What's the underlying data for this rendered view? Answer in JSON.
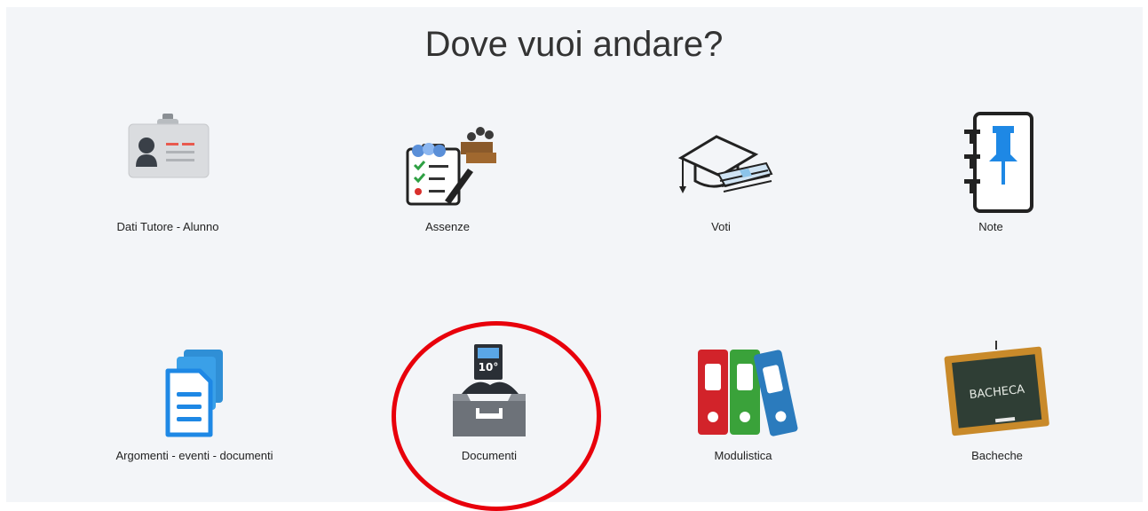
{
  "heading": "Dove vuoi andare?",
  "menu": [
    {
      "label": "Dati Tutore - Alunno",
      "icon": "id-badge-icon"
    },
    {
      "label": "Assenze",
      "icon": "attendance-clipboard-icon"
    },
    {
      "label": "Voti",
      "icon": "graduation-cap-icon"
    },
    {
      "label": "Note",
      "icon": "notebook-pin-icon"
    },
    {
      "label": "Argomenti - eventi - documenti",
      "icon": "documents-stack-icon"
    },
    {
      "label": "Documenti",
      "icon": "document-inbox-icon",
      "highlighted": true
    },
    {
      "label": "Modulistica",
      "icon": "binders-icon"
    },
    {
      "label": "Bacheche",
      "icon": "chalkboard-icon"
    }
  ],
  "icon_texts": {
    "bacheca_board": "BACHECA",
    "doc_badge": "10°"
  },
  "colors": {
    "panel_bg": "#f3f5f8",
    "highlight": "#e8000b",
    "binder_red": "#d2232a",
    "binder_green": "#3aa23a",
    "binder_blue": "#2b7bbd",
    "pin_blue": "#1e88e5"
  }
}
